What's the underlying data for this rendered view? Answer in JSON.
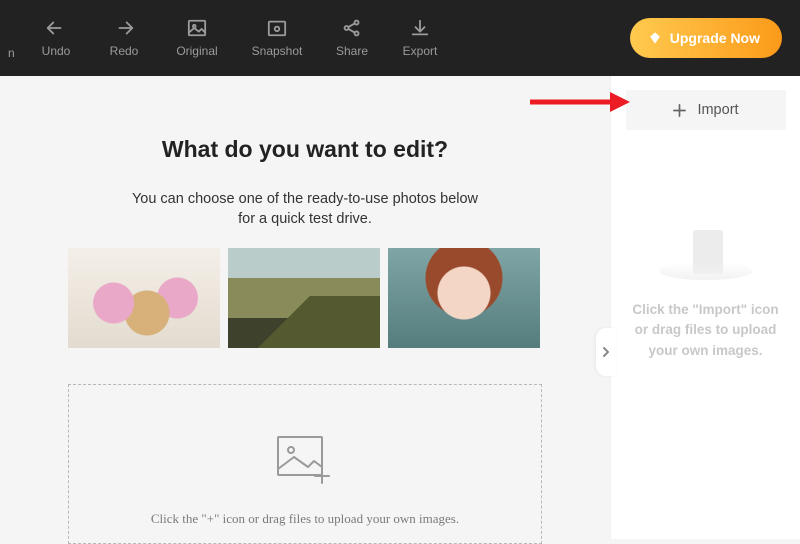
{
  "toolbar": {
    "edge_text": "n",
    "undo": "Undo",
    "redo": "Redo",
    "original": "Original",
    "snapshot": "Snapshot",
    "share": "Share",
    "export": "Export",
    "upgrade": "Upgrade Now"
  },
  "workspace": {
    "headline": "What do you want to edit?",
    "subhead": "You can choose one of the ready-to-use photos below\nfor a quick test drive.",
    "dropzone_text": "Click the \"+\" icon or drag files to upload your own images."
  },
  "right": {
    "import": "Import",
    "hint": "Click the \"Import\" icon or drag files to upload your own images."
  }
}
